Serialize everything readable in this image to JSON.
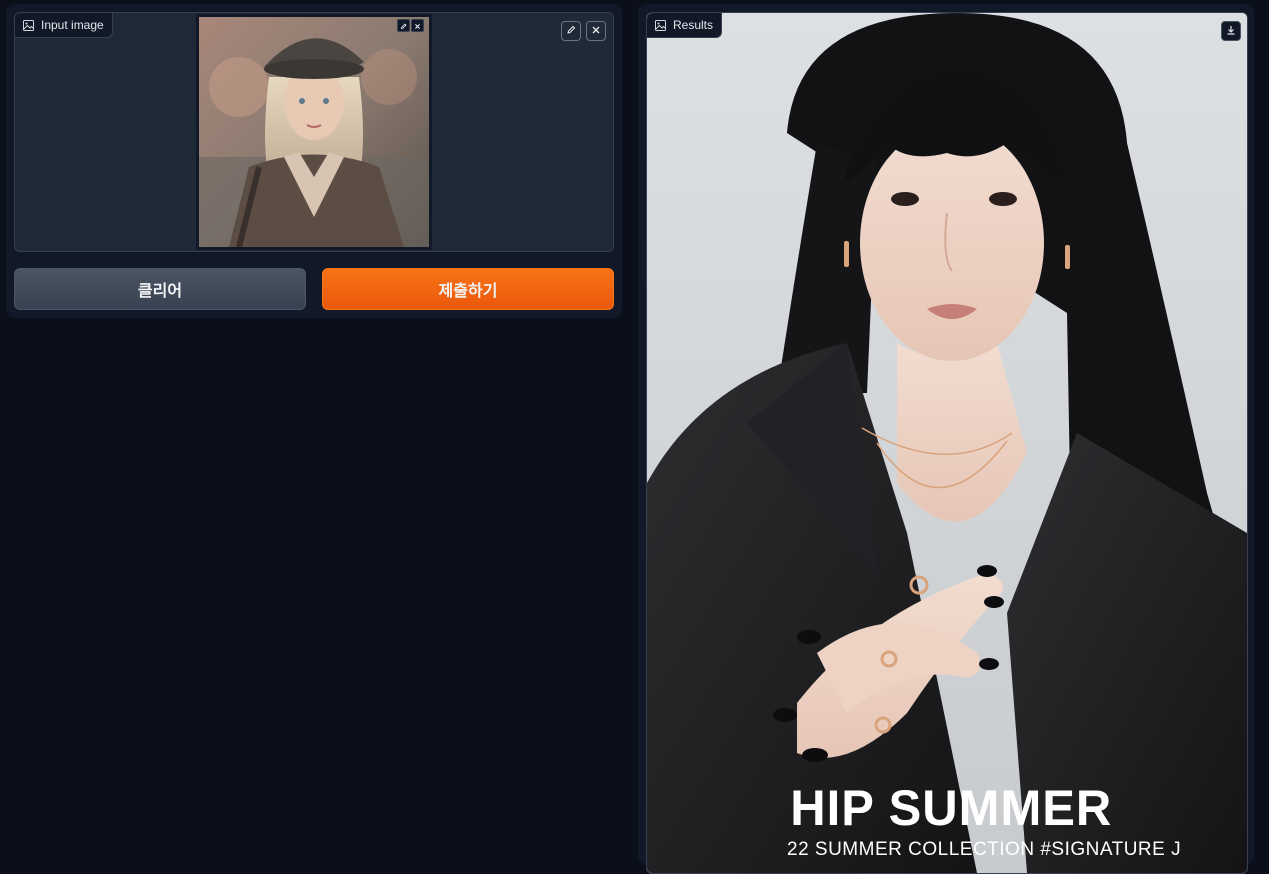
{
  "input_panel": {
    "label": "Input image",
    "icon": "image-icon"
  },
  "buttons": {
    "clear_label": "클리어",
    "submit_label": "제출하기"
  },
  "results_panel": {
    "label": "Results",
    "icon": "image-icon",
    "poster_title": "HIP SUMMER",
    "poster_subtitle": "22 SUMMER COLLECTION #SIGNATURE J"
  },
  "colors": {
    "page_background": "#0b0f19",
    "panel_background": "#1f2937",
    "submit_accent": "#f97316",
    "clear_button": "#4b5563"
  }
}
